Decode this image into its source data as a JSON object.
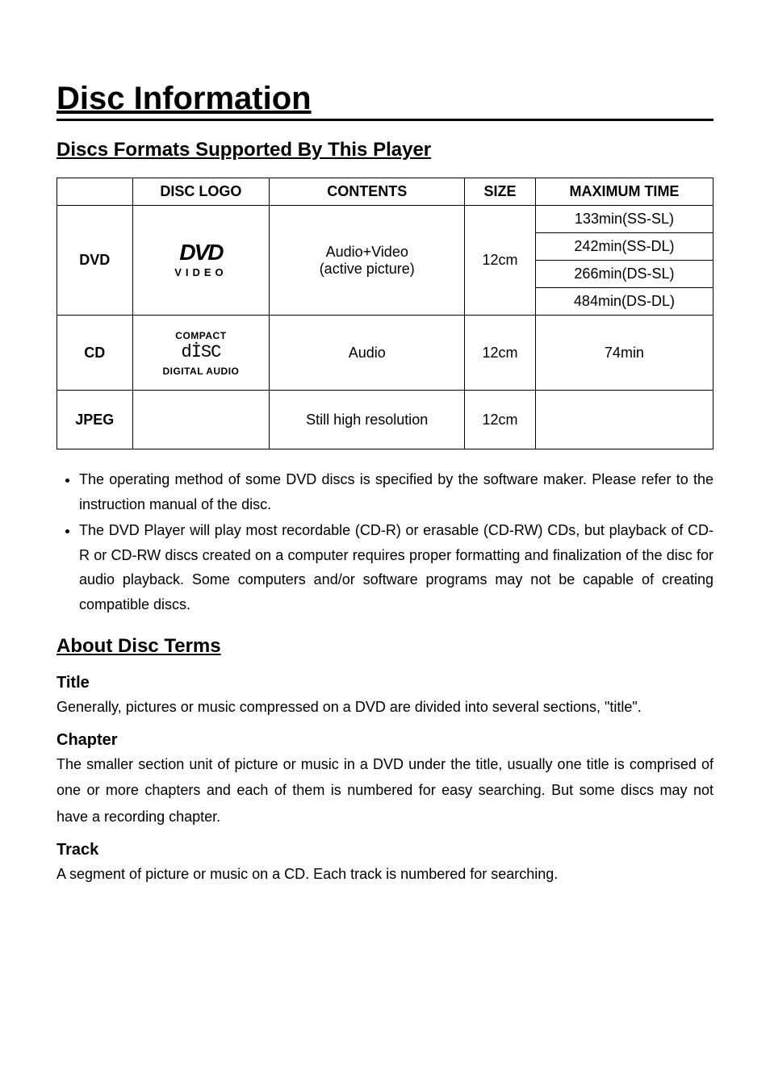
{
  "title": "Disc Information",
  "section1_title": "Discs Formats Supported By This Player",
  "table": {
    "headers": {
      "col1": "",
      "logo": "DISC LOGO",
      "contents": "CONTENTS",
      "size": "SIZE",
      "maxtime": "MAXIMUM TIME"
    },
    "rows": {
      "dvd": {
        "label": "DVD",
        "logo": {
          "top": "DVD",
          "bottom": "VIDEO"
        },
        "contents_l1": "Audio+Video",
        "contents_l2": "(active picture)",
        "size": "12cm",
        "times": [
          "133min(SS-SL)",
          "242min(SS-DL)",
          "266min(DS-SL)",
          "484min(DS-DL)"
        ]
      },
      "cd": {
        "label": "CD",
        "logo": {
          "top": "COMPACT",
          "mid": "dİSC",
          "bottom": "DIGITAL AUDIO"
        },
        "contents": "Audio",
        "size": "12cm",
        "time": "74min"
      },
      "jpeg": {
        "label": "JPEG",
        "contents": "Still high resolution",
        "size": "12cm",
        "time": ""
      }
    }
  },
  "bullets": [
    "The operating method of some DVD discs is specified by the software maker. Please refer to the instruction manual of the disc.",
    "The DVD Player will play most recordable (CD-R) or erasable (CD-RW) CDs, but playback of CD-R or CD-RW discs created on a computer requires proper formatting and finalization of the disc for audio playback. Some computers and/or software programs may not be capable of creating compatible discs."
  ],
  "section2_title": "About Disc Terms",
  "terms": {
    "title": {
      "heading": "Title",
      "body": "Generally, pictures or music compressed on a DVD are divided into several sections, \"title\"."
    },
    "chapter": {
      "heading": "Chapter",
      "body": "The smaller section unit of picture or music in a DVD under the title, usually one title is comprised of one or more chapters and each of them is numbered for easy searching. But some discs may not have a recording chapter."
    },
    "track": {
      "heading": "Track",
      "body": "A segment of picture or music on a CD. Each track is numbered for searching."
    }
  }
}
